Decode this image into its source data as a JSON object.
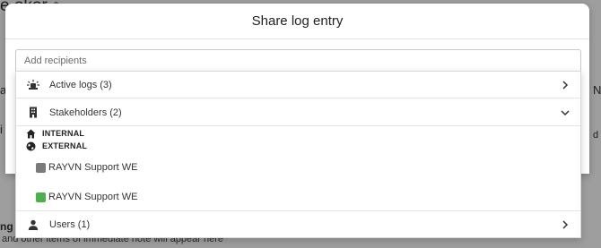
{
  "background": {
    "title_fragment": "e okor",
    "side_letter_left_1": "a",
    "side_letter_left_2": "i",
    "side_letter_right_1": "N",
    "side_letter_right_2": "d",
    "bottom_heading_fragment": "ng",
    "bottom_text": "and other items of immediate note will appear here"
  },
  "modal": {
    "title": "Share log entry",
    "recipients_placeholder": "Add recipients"
  },
  "dropdown": {
    "groups": {
      "active_logs": {
        "label": "Active logs (3)",
        "icon": "alarm-light-icon",
        "state": "collapsed"
      },
      "stakeholders": {
        "label": "Stakeholders (2)",
        "icon": "building-icon",
        "state": "expanded"
      },
      "users": {
        "label": "Users (1)",
        "icon": "person-icon",
        "state": "collapsed"
      }
    },
    "sections": {
      "internal": {
        "label": "INTERNAL",
        "icon": "home-icon"
      },
      "external": {
        "label": "EXTERNAL",
        "icon": "globe-icon"
      }
    },
    "recipients": [
      {
        "label": "RAYVN Support WE",
        "color": "#7a7a7a"
      },
      {
        "label": "RAYVN Support WE",
        "color": "#4caf50"
      }
    ]
  }
}
